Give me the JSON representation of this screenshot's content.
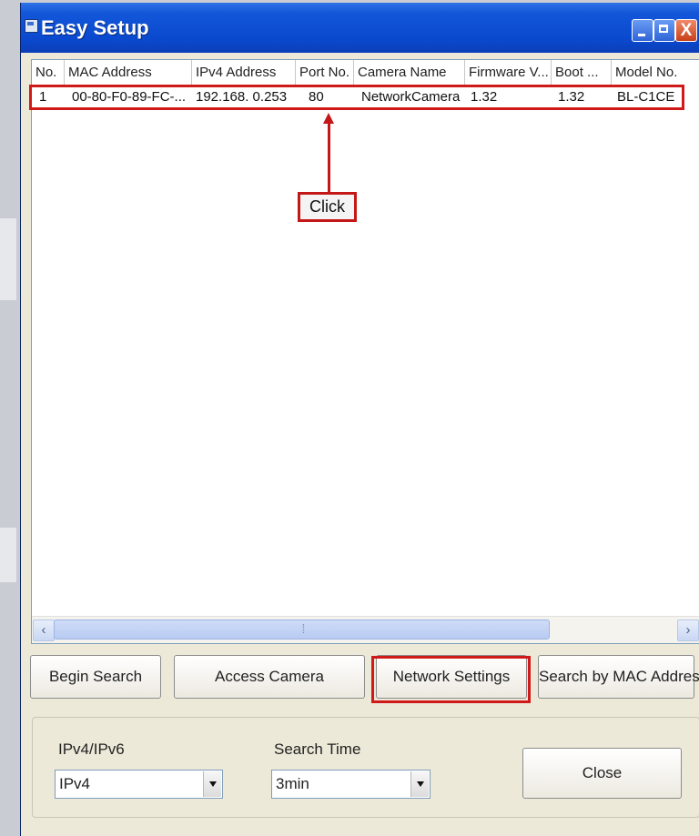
{
  "window": {
    "title": "Easy Setup"
  },
  "columns": [
    "No.",
    "MAC Address",
    "IPv4 Address",
    "Port No.",
    "Camera Name",
    "Firmware V...",
    "Boot ...",
    "Model No."
  ],
  "rows": [
    [
      "1",
      "00-80-F0-89-FC-...",
      "192.168. 0.253",
      "80",
      "NetworkCamera",
      "1.32",
      "1.32",
      "BL-C1CE"
    ]
  ],
  "annotation": {
    "click_label": "Click"
  },
  "scroll": {
    "left": "‹",
    "right": "›"
  },
  "buttons": {
    "begin_search": "Begin Search",
    "access_camera": "Access Camera",
    "network_settings": "Network Settings",
    "search_by_mac": "Search by MAC Address",
    "close": "Close"
  },
  "options": {
    "ip_label": "IPv4/IPv6",
    "ip_value": "IPv4",
    "search_time_label": "Search Time",
    "search_time_value": "3min"
  },
  "colors": {
    "highlight": "#d01a1a",
    "titlebar": "#0a4ad0"
  }
}
